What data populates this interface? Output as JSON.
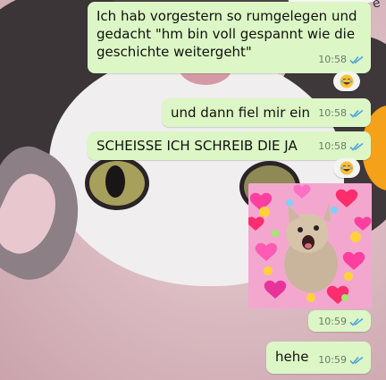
{
  "messages": [
    {
      "text": "Ich hab vorgestern so rumgelegen und\ngedacht \"hm bin voll gespannt wie die\ngeschichte weitergeht\"",
      "time": "10:58",
      "read": true,
      "reaction": "laughing-emoji"
    },
    {
      "text": "und dann fiel mir ein",
      "time": "10:58",
      "read": true
    },
    {
      "text": "SCHEISSE ICH SCHREIB DIE JA",
      "time": "10:58",
      "read": true,
      "reaction": "laughing-emoji"
    },
    {
      "sticker": "screaming-kitten-hearts-sticker",
      "time": "10:59",
      "read": true
    },
    {
      "text": "hehe",
      "time": "10:59",
      "read": true
    }
  ],
  "colors": {
    "outgoing_bubble": "#dcf7c5",
    "read_ticks": "#4fa3e0",
    "timestamp": "#6c7a6c"
  },
  "corner_text": "e"
}
